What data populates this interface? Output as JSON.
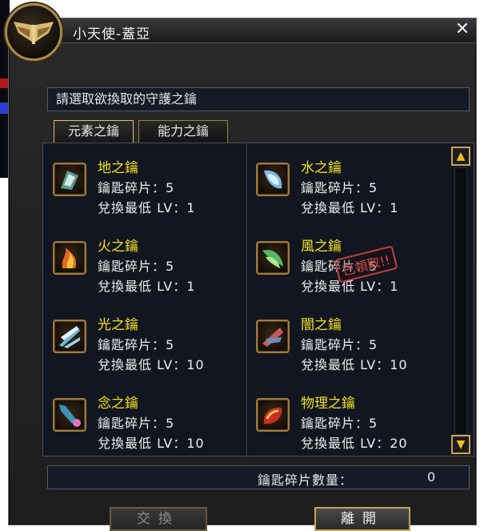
{
  "window": {
    "title": "小天使-蓋亞",
    "close_glyph": "✕",
    "prompt": "請選取欲換取的守護之鑰"
  },
  "tabs": [
    {
      "label": "元素之鑰",
      "active": true
    },
    {
      "label": "能力之鑰",
      "active": false
    }
  ],
  "items": [
    {
      "name": "地之鑰",
      "fragments": "鑰匙碎片：5",
      "min_level": "兌換最低 LV：1",
      "icon": "earth-key-icon",
      "colors": [
        "#6aa8a0",
        "#e0e0d0"
      ]
    },
    {
      "name": "水之鑰",
      "fragments": "鑰匙碎片：5",
      "min_level": "兌換最低 LV：1",
      "icon": "water-key-icon",
      "colors": [
        "#7ac0e8",
        "#d8f0ff"
      ]
    },
    {
      "name": "火之鑰",
      "fragments": "鑰匙碎片：5",
      "min_level": "兌換最低 LV：1",
      "icon": "fire-key-icon",
      "colors": [
        "#e86a20",
        "#f0c040"
      ]
    },
    {
      "name": "風之鑰",
      "fragments": "鑰匙碎片：5",
      "min_level": "兌換最低 LV：1",
      "icon": "wind-key-icon",
      "colors": [
        "#60c070",
        "#b0e890"
      ],
      "stamp": "已領取!!"
    },
    {
      "name": "光之鑰",
      "fragments": "鑰匙碎片：5",
      "min_level": "兌換最低 LV：10",
      "icon": "light-key-icon",
      "colors": [
        "#70c0e0",
        "#f0f0f0"
      ]
    },
    {
      "name": "闇之鑰",
      "fragments": "鑰匙碎片：5",
      "min_level": "兌換最低 LV：10",
      "icon": "dark-key-icon",
      "colors": [
        "#d06060",
        "#6a90c0"
      ]
    },
    {
      "name": "念之鑰",
      "fragments": "鑰匙碎片：5",
      "min_level": "兌換最低 LV：10",
      "icon": "mind-key-icon",
      "colors": [
        "#40a0c0",
        "#e070c0"
      ]
    },
    {
      "name": "物理之鑰",
      "fragments": "鑰匙碎片：5",
      "min_level": "兌換最低 LV：20",
      "icon": "physical-key-icon",
      "colors": [
        "#d03020",
        "#f0c060"
      ]
    }
  ],
  "footer": {
    "count_label": "鑰匙碎片數量：",
    "count_value": "0",
    "exchange_label": "交換",
    "leave_label": "離開"
  }
}
